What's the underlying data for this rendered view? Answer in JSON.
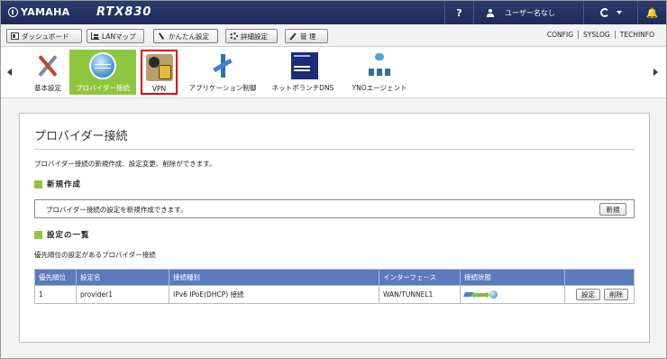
{
  "header": {
    "brand": "YAMAHA",
    "model": "RTX830",
    "help": "?",
    "user": "ユーザー名なし"
  },
  "menu": {
    "tabs": [
      {
        "label": "ダッシュボード"
      },
      {
        "label": "LANマップ"
      },
      {
        "label": "かんたん設定"
      },
      {
        "label": "詳細設定"
      },
      {
        "label": "管 理"
      }
    ],
    "links": [
      "CONFIG",
      "SYSLOG",
      "TECHINFO"
    ]
  },
  "toolbar": {
    "items": [
      {
        "label": "基本設定",
        "icon": "tools-icon"
      },
      {
        "label": "プロバイダー接続",
        "icon": "globe-icon"
      },
      {
        "label": "VPN",
        "icon": "vpn-lock-icon"
      },
      {
        "label": "アプリケーション制御",
        "icon": "app-control-icon"
      },
      {
        "label": "ネットボランチDNS",
        "icon": "ddns-service-icon"
      },
      {
        "label": "YNOエージェント",
        "icon": "yno-agent-icon"
      }
    ]
  },
  "page": {
    "title": "プロバイダー接続",
    "description": "プロバイダー接続の新規作成、設定変更、削除ができます。",
    "new_section": {
      "heading": "新規作成",
      "text": "プロバイダー接続の設定を新規作成できます。",
      "button": "新規"
    },
    "list_section": {
      "heading": "設定の一覧",
      "subtitle": "優先順位の設定があるプロバイダー接続",
      "columns": [
        "優先順位",
        "設定名",
        "接続種別",
        "インターフェース",
        "接続状態",
        ""
      ],
      "rows": [
        {
          "priority": "1",
          "name": "provider1",
          "type": "IPv6 IPoE(DHCP) 接続",
          "interface": "WAN/TUNNEL1",
          "status": "connected",
          "edit": "設定",
          "delete": "削除"
        }
      ]
    }
  },
  "colors": {
    "header": "#1d2c57",
    "accent_green": "#8fc63f",
    "table_header": "#5b7bbd",
    "highlight": "#e00000"
  }
}
